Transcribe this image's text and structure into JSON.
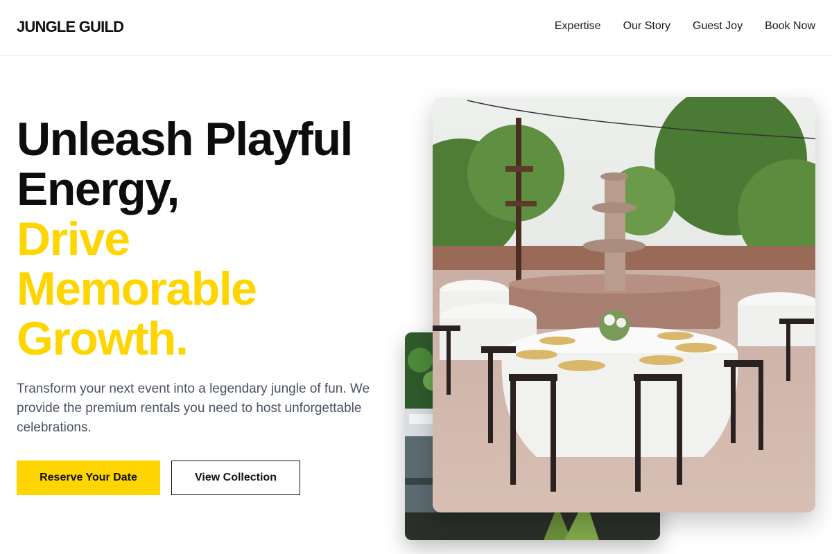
{
  "brand": {
    "logo_text": "JUNGLE GUILD"
  },
  "nav": {
    "items": [
      {
        "label": "Expertise"
      },
      {
        "label": "Our Story"
      },
      {
        "label": "Guest Joy"
      },
      {
        "label": "Book Now"
      }
    ]
  },
  "hero": {
    "headline_line1": "Unleash Playful",
    "headline_line2": "Energy,",
    "headline_accent_line1": "Drive",
    "headline_accent_line2": "Memorable",
    "headline_accent_line3": "Growth.",
    "description": "Transform your next event into a legendary jungle of fun. We provide the premium rentals you need to host unforgettable celebrations.",
    "primary_button": "Reserve Your Date",
    "secondary_button": "View Collection"
  },
  "colors": {
    "accent": "#ffd500",
    "text_dark": "#0d0d0d",
    "text_muted": "#4a5360"
  },
  "images": [
    {
      "name": "outdoor-banquet-photo",
      "description_icon": "image-icon"
    },
    {
      "name": "marina-boats-photo",
      "description_icon": "image-icon"
    }
  ]
}
